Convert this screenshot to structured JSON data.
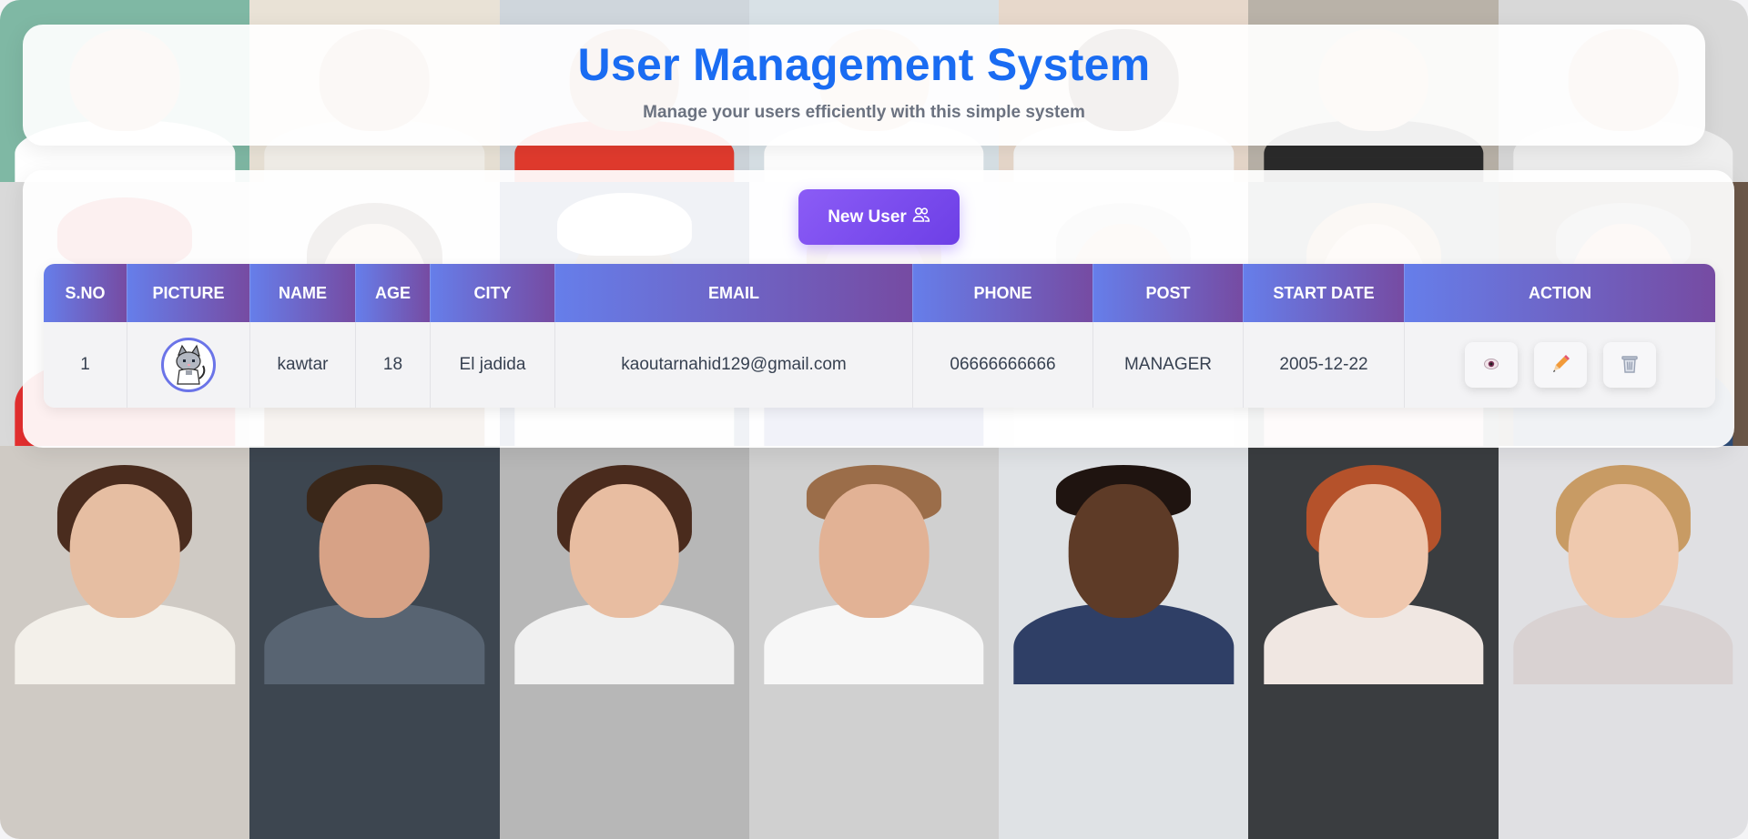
{
  "header": {
    "title": "User Management System",
    "subtitle": "Manage your users efficiently with this simple system"
  },
  "toolbar": {
    "new_user_label": "New User"
  },
  "table": {
    "headers": [
      "S.NO",
      "PICTURE",
      "NAME",
      "AGE",
      "CITY",
      "EMAIL",
      "PHONE",
      "POST",
      "START DATE",
      "ACTION"
    ],
    "rows": [
      {
        "sno": "1",
        "picture_icon": "cat-avatar-icon",
        "name": "kawtar",
        "age": "18",
        "city": "El jadida",
        "email": "kaoutarnahid129@gmail.com",
        "phone": "06666666666",
        "post": "MANAGER",
        "start_date": "2005-12-22"
      }
    ],
    "action_icons": [
      "eye-icon",
      "pencil-icon",
      "trash-icon"
    ]
  },
  "colors": {
    "title": "#1a6cf2",
    "header_gradient_start": "#667eea",
    "header_gradient_end": "#764ba2",
    "button": "#7c4dff"
  }
}
